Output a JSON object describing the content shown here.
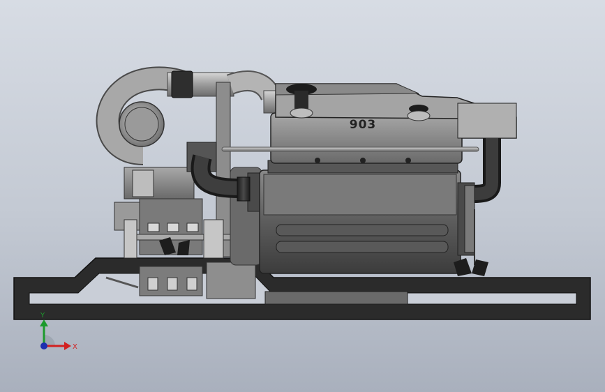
{
  "viewport": {
    "background_top": "#d7dce4",
    "background_bottom": "#a9b0bd"
  },
  "model": {
    "engine_label": "903",
    "frame_color": "#2a2a2a",
    "body_color": "#6e6e6e",
    "hose_color": "#2b2b2b",
    "pipe_color": "#b8b8b8"
  },
  "triad": {
    "y_label": "Y",
    "x_label": "X",
    "x_color": "#d22020",
    "y_color": "#1c9a2c",
    "z_color": "#1d2fb0"
  }
}
